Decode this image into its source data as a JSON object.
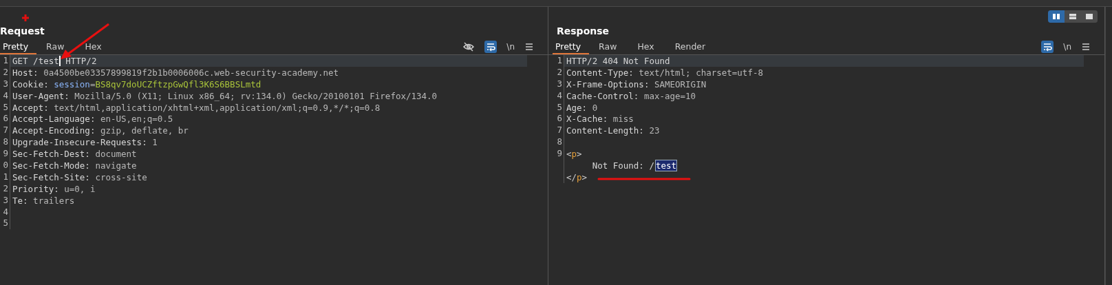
{
  "layout_toggle": [
    {
      "kind": "columns",
      "selected": true
    },
    {
      "kind": "rows",
      "selected": false
    },
    {
      "kind": "single",
      "selected": false
    }
  ],
  "request": {
    "title": "Request",
    "tabs": [
      {
        "label": "Pretty",
        "selected": true
      },
      {
        "label": "Raw",
        "selected": false
      },
      {
        "label": "Hex",
        "selected": false
      }
    ],
    "tools": [
      {
        "kind": "hide"
      },
      {
        "kind": "wrap",
        "on": true
      },
      {
        "kind": "newline",
        "label": "\\n"
      },
      {
        "kind": "menu"
      }
    ],
    "lines": [
      {
        "number": "1",
        "current": true,
        "segments": [
          {
            "kind": "plain",
            "text": "GET /test"
          },
          {
            "kind": "cursor"
          },
          {
            "kind": "plain",
            "text": " HTTP/2"
          }
        ]
      },
      {
        "number": "2",
        "current": false,
        "segments": [
          {
            "kind": "key",
            "text": "Host: "
          },
          {
            "kind": "value",
            "text": "0a4500be03357899819f2b1b0006006c.web-security-academy.net"
          }
        ]
      },
      {
        "number": "3",
        "current": false,
        "segments": [
          {
            "kind": "key",
            "text": "Cookie: "
          },
          {
            "kind": "param",
            "text": "session"
          },
          {
            "kind": "value",
            "text": "="
          },
          {
            "kind": "cookie",
            "text": "BS8qv7doUCZftzpGwQfl3K6S6BBSLmtd"
          }
        ]
      },
      {
        "number": "4",
        "current": false,
        "segments": [
          {
            "kind": "key",
            "text": "User-Agent: "
          },
          {
            "kind": "value",
            "text": "Mozilla/5.0 (X11; Linux x86_64; rv:134.0) Gecko/20100101 Firefox/134.0"
          }
        ]
      },
      {
        "number": "5",
        "current": false,
        "segments": [
          {
            "kind": "key",
            "text": "Accept: "
          },
          {
            "kind": "value",
            "text": "text/html,application/xhtml+xml,application/xml;q=0.9,*/*;q=0.8"
          }
        ]
      },
      {
        "number": "6",
        "current": false,
        "segments": [
          {
            "kind": "key",
            "text": "Accept-Language: "
          },
          {
            "kind": "value",
            "text": "en-US,en;q=0.5"
          }
        ]
      },
      {
        "number": "7",
        "current": false,
        "segments": [
          {
            "kind": "key",
            "text": "Accept-Encoding: "
          },
          {
            "kind": "value",
            "text": "gzip, deflate, br"
          }
        ]
      },
      {
        "number": "8",
        "current": false,
        "segments": [
          {
            "kind": "key",
            "text": "Upgrade-Insecure-Requests: "
          },
          {
            "kind": "value",
            "text": "1"
          }
        ]
      },
      {
        "number": "9",
        "current": false,
        "segments": [
          {
            "kind": "key",
            "text": "Sec-Fetch-Dest: "
          },
          {
            "kind": "value",
            "text": "document"
          }
        ]
      },
      {
        "number": "0",
        "current": false,
        "segments": [
          {
            "kind": "key",
            "text": "Sec-Fetch-Mode: "
          },
          {
            "kind": "value",
            "text": "navigate"
          }
        ]
      },
      {
        "number": "1",
        "current": false,
        "segments": [
          {
            "kind": "key",
            "text": "Sec-Fetch-Site: "
          },
          {
            "kind": "value",
            "text": "cross-site"
          }
        ]
      },
      {
        "number": "2",
        "current": false,
        "segments": [
          {
            "kind": "key",
            "text": "Priority: "
          },
          {
            "kind": "value",
            "text": "u=0, i"
          }
        ]
      },
      {
        "number": "3",
        "current": false,
        "segments": [
          {
            "kind": "key",
            "text": "Te: "
          },
          {
            "kind": "value",
            "text": "trailers"
          }
        ]
      },
      {
        "number": "4",
        "current": false
      },
      {
        "number": "5",
        "current": false
      }
    ]
  },
  "response": {
    "title": "Response",
    "tabs": [
      {
        "label": "Pretty",
        "selected": true
      },
      {
        "label": "Raw",
        "selected": false
      },
      {
        "label": "Hex",
        "selected": false
      },
      {
        "label": "Render",
        "selected": false
      }
    ],
    "tools": [
      {
        "kind": "wrap",
        "on": true
      },
      {
        "kind": "newline",
        "label": "\\n"
      },
      {
        "kind": "menu"
      }
    ],
    "lines": [
      {
        "number": "1",
        "current": true,
        "segments": [
          {
            "kind": "plain",
            "text": "HTTP/2 404 Not Found"
          }
        ]
      },
      {
        "number": "2",
        "current": false,
        "segments": [
          {
            "kind": "key",
            "text": "Content-Type: "
          },
          {
            "kind": "value",
            "text": "text/html; charset=utf-8"
          }
        ]
      },
      {
        "number": "3",
        "current": false,
        "segments": [
          {
            "kind": "key",
            "text": "X-Frame-Options: "
          },
          {
            "kind": "value",
            "text": "SAMEORIGIN"
          }
        ]
      },
      {
        "number": "4",
        "current": false,
        "segments": [
          {
            "kind": "key",
            "text": "Cache-Control: "
          },
          {
            "kind": "value",
            "text": "max-age=10"
          }
        ]
      },
      {
        "number": "5",
        "current": false,
        "segments": [
          {
            "kind": "key",
            "text": "Age: "
          },
          {
            "kind": "value",
            "text": "0"
          }
        ]
      },
      {
        "number": "6",
        "current": false,
        "segments": [
          {
            "kind": "key",
            "text": "X-Cache: "
          },
          {
            "kind": "value",
            "text": "miss"
          }
        ]
      },
      {
        "number": "7",
        "current": false,
        "segments": [
          {
            "kind": "key",
            "text": "Content-Length: "
          },
          {
            "kind": "value",
            "text": "23"
          }
        ]
      },
      {
        "number": "8",
        "current": false
      },
      {
        "number": "9",
        "current": false,
        "segments": [
          {
            "kind": "bracket",
            "text": "<"
          },
          {
            "kind": "tag",
            "text": "p"
          },
          {
            "kind": "bracket",
            "text": ">"
          }
        ]
      },
      {
        "current": false,
        "segments": [
          {
            "kind": "plain",
            "text": "     Not Found: /"
          },
          {
            "kind": "selected",
            "text": "test"
          }
        ]
      },
      {
        "current": false,
        "segments": [
          {
            "kind": "bracket",
            "text": "</"
          },
          {
            "kind": "tag",
            "text": "p"
          },
          {
            "kind": "bracket",
            "text": ">"
          }
        ]
      }
    ]
  }
}
